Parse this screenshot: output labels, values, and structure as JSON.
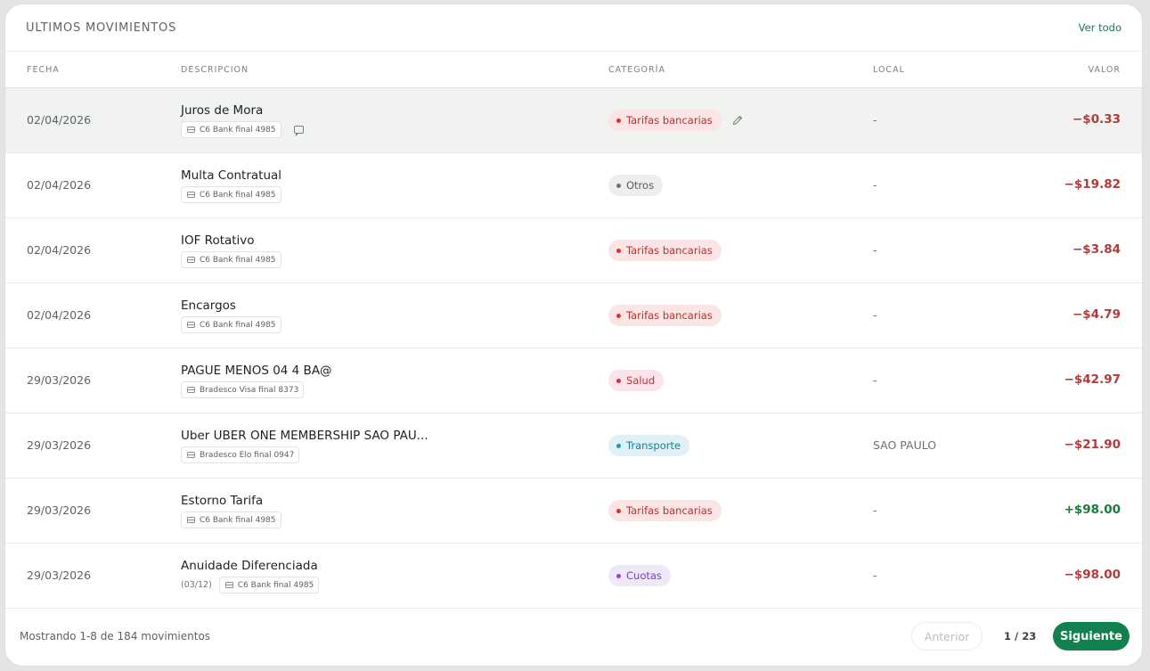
{
  "header": {
    "title": "ULTIMOS MOVIMIENTOS",
    "see_all": "Ver todo"
  },
  "columns": {
    "date": "FECHA",
    "desc": "DESCRIPCION",
    "category": "CATEGORÍA",
    "local": "LOCAL",
    "value": "VALOR"
  },
  "colors": {
    "accent": "#13814d",
    "negative": "#b33a3a",
    "positive": "#1a7a3c"
  },
  "categories": {
    "Tarifas bancarias": {
      "bg": "#fbe4e4",
      "fg": "#b33232",
      "dot": "#d9302f"
    },
    "Otros": {
      "bg": "#eceeef",
      "fg": "#555c60",
      "dot": "#6b7378"
    },
    "Salud": {
      "bg": "#fbe4e8",
      "fg": "#b6324a",
      "dot": "#d92d46"
    },
    "Transporte": {
      "bg": "#dff1f6",
      "fg": "#1c7b94",
      "dot": "#1c98b8"
    },
    "Cuotas": {
      "bg": "#efe8fb",
      "fg": "#7040c0",
      "dot": "#8a48e0"
    }
  },
  "rows": [
    {
      "date": "02/04/2026",
      "title": "Juros de Mora",
      "installment": "",
      "account": "C6 Bank final 4985",
      "comment": true,
      "category": "Tarifas bancarias",
      "edit": true,
      "local": "-",
      "value": "−$0.33",
      "sign": "neg",
      "hover": true
    },
    {
      "date": "02/04/2026",
      "title": "Multa Contratual",
      "installment": "",
      "account": "C6 Bank final 4985",
      "comment": false,
      "category": "Otros",
      "edit": false,
      "local": "-",
      "value": "−$19.82",
      "sign": "neg",
      "hover": false
    },
    {
      "date": "02/04/2026",
      "title": "IOF Rotativo",
      "installment": "",
      "account": "C6 Bank final 4985",
      "comment": false,
      "category": "Tarifas bancarias",
      "edit": false,
      "local": "-",
      "value": "−$3.84",
      "sign": "neg",
      "hover": false
    },
    {
      "date": "02/04/2026",
      "title": "Encargos",
      "installment": "",
      "account": "C6 Bank final 4985",
      "comment": false,
      "category": "Tarifas bancarias",
      "edit": false,
      "local": "-",
      "value": "−$4.79",
      "sign": "neg",
      "hover": false
    },
    {
      "date": "29/03/2026",
      "title": "PAGUE MENOS 04 4 BA@",
      "installment": "",
      "account": "Bradesco Visa final 8373",
      "comment": false,
      "category": "Salud",
      "edit": false,
      "local": "-",
      "value": "−$42.97",
      "sign": "neg",
      "hover": false
    },
    {
      "date": "29/03/2026",
      "title": "Uber UBER ONE MEMBERSHIP SAO PAU...",
      "installment": "",
      "account": "Bradesco Elo final 0947",
      "comment": false,
      "category": "Transporte",
      "edit": false,
      "local": "SAO PAULO",
      "value": "−$21.90",
      "sign": "neg",
      "hover": false
    },
    {
      "date": "29/03/2026",
      "title": "Estorno Tarifa",
      "installment": "",
      "account": "C6 Bank final 4985",
      "comment": false,
      "category": "Tarifas bancarias",
      "edit": false,
      "local": "-",
      "value": "+$98.00",
      "sign": "pos",
      "hover": false
    },
    {
      "date": "29/03/2026",
      "title": "Anuidade Diferenciada",
      "installment": "(03/12)",
      "account": "C6 Bank final 4985",
      "comment": false,
      "category": "Cuotas",
      "edit": false,
      "local": "-",
      "value": "−$98.00",
      "sign": "neg",
      "hover": false
    }
  ],
  "footer": {
    "showing": "Mostrando 1-8 de 184 movimientos",
    "prev": "Anterior",
    "pages": "1 / 23",
    "next": "Siguiente"
  }
}
